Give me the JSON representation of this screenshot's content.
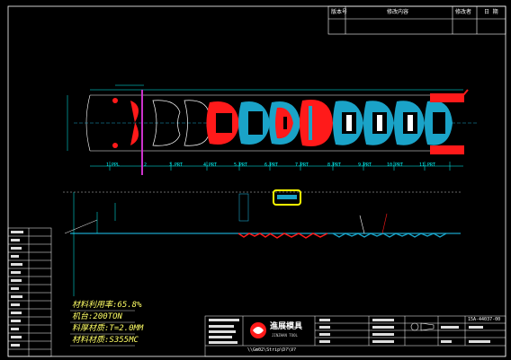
{
  "revision_table": {
    "headers": [
      "版本号",
      "修改内容",
      "修改者",
      "日 期"
    ]
  },
  "notes": {
    "material_utilization": "材料利用率:65.8%",
    "press": "机台:200TON",
    "thickness": "料厚材质:T=2.0MM",
    "material": "材料材质:S355MC"
  },
  "stations": [
    "1.PPL",
    "2",
    "3.PRT",
    "4.PRT",
    "5.PRT",
    "6.PRT",
    "7.PRT",
    "8.PRT",
    "9.PRT",
    "10.PRT",
    "11.PRT"
  ],
  "title_block": {
    "company_name": "進展模具",
    "company_name_en": "JINZHAN TOOL",
    "drawing_no": "15A-44037-00",
    "file_path": "\\\\Gm02\\Strip\\D?\\V?"
  },
  "colors": {
    "background": "#000000",
    "frame": "#ffffff",
    "part_red": "#ff1a1a",
    "part_cyan": "#1aa3c8",
    "dim_cyan": "#00ffff",
    "label_yellow": "#ffff66",
    "pilot_magenta": "#cc33cc"
  }
}
